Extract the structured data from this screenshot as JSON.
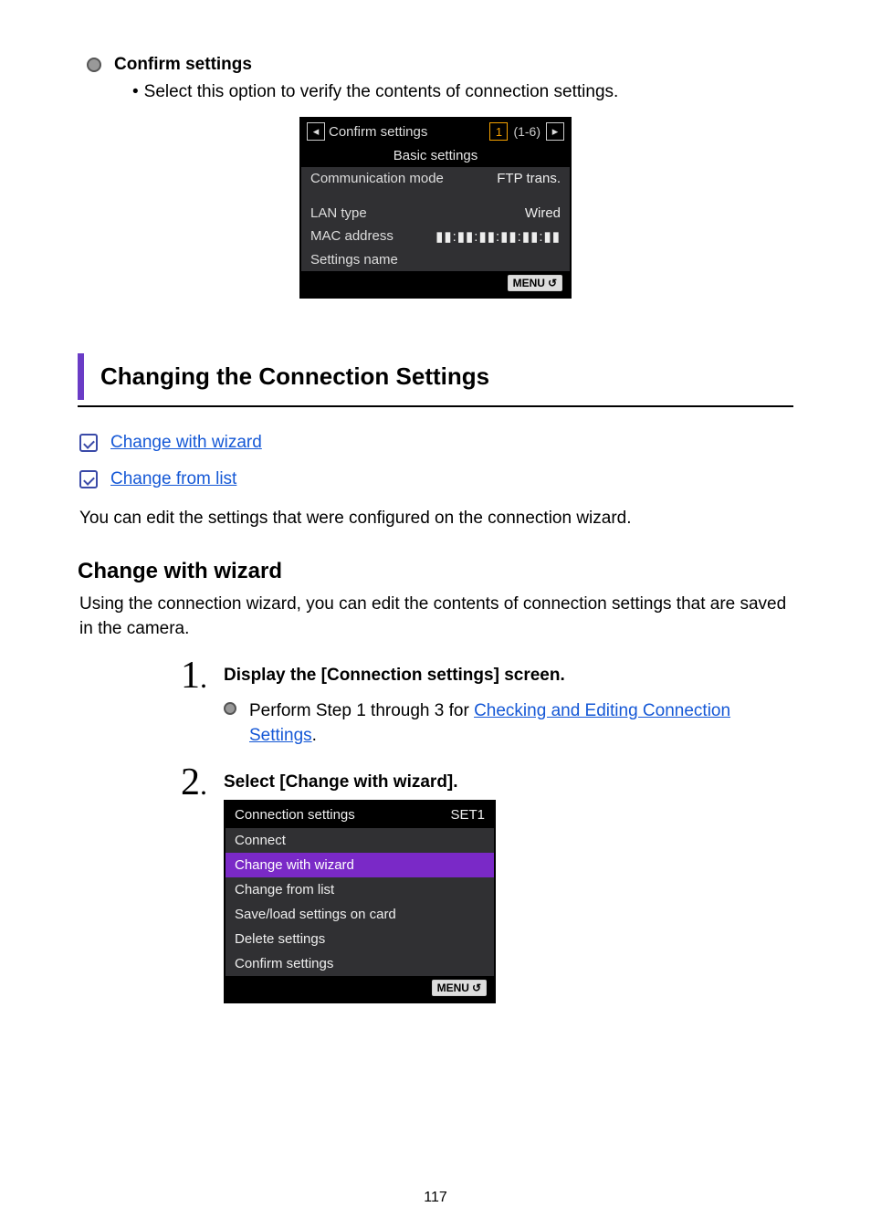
{
  "top_section": {
    "title": "Confirm settings",
    "desc_bullet": "•",
    "desc": "Select this option to verify the contents of connection settings."
  },
  "cam1": {
    "prev_glyph": "◂",
    "title": "Confirm settings",
    "page_current": "1",
    "page_total": "(1-6)",
    "next_glyph": "▸",
    "section_title": "Basic settings",
    "rows": {
      "r1_label": "Communication mode",
      "r1_value": "FTP trans.",
      "r2_label": "LAN type",
      "r2_value": "Wired",
      "r3_label": "MAC address",
      "r3_value": "▮▮:▮▮:▮▮:▮▮:▮▮:▮▮",
      "r4_label": "Settings name",
      "r4_value": ""
    },
    "menu_label": "MENU",
    "menu_return_glyph": "↺"
  },
  "section_heading": "Changing the Connection Settings",
  "links": {
    "l1": "Change with wizard",
    "l2": "Change from list"
  },
  "intro_para": "You can edit the settings that were configured on the connection wizard.",
  "sub_heading": "Change with wizard",
  "wizard_para": "Using the connection wizard, you can edit the contents of connection settings that are saved in the camera.",
  "steps": {
    "s1": {
      "num": "1",
      "dot": ".",
      "title": "Display the [Connection settings] screen.",
      "bullet_lead": "Perform Step 1 through 3 for ",
      "bullet_link": "Checking and Editing Connection Settings",
      "bullet_tail": "."
    },
    "s2": {
      "num": "2",
      "dot": ".",
      "title": "Select [Change with wizard]."
    }
  },
  "cam2": {
    "header_left": "Connection settings",
    "header_right": "SET1",
    "rows": {
      "r1": "Connect",
      "r2": "Change with wizard",
      "r3": "Change from list",
      "r4": "Save/load settings on card",
      "r5": "Delete settings",
      "r6": "Confirm settings"
    },
    "menu_label": "MENU",
    "menu_return_glyph": "↺"
  },
  "page_number": "117"
}
